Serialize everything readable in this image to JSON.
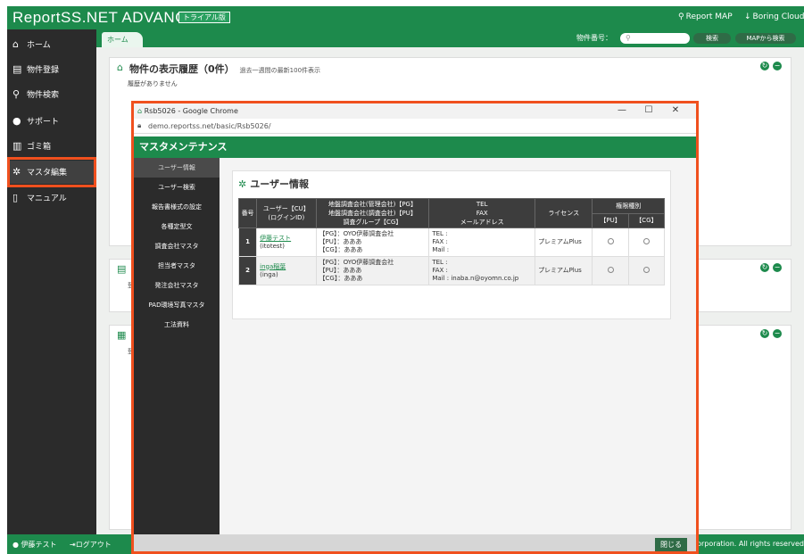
{
  "header": {
    "brand": "ReportSS.NET ADVANCE",
    "trial_badge": "トライアル版",
    "report_map": "Report MAP",
    "boring_cloud": "Boring Cloud"
  },
  "sidebar": {
    "items": [
      {
        "label": "ホーム",
        "icon": "home-icon"
      },
      {
        "label": "物件登録",
        "icon": "register-icon"
      },
      {
        "label": "物件検索",
        "icon": "search-icon"
      },
      {
        "label": "サポート",
        "icon": "user-icon"
      },
      {
        "label": "ゴミ箱",
        "icon": "trash-icon"
      },
      {
        "label": "マスタ編集",
        "icon": "gear-icon"
      },
      {
        "label": "マニュアル",
        "icon": "book-icon"
      }
    ]
  },
  "tabs": {
    "home": "ホーム",
    "search_label": "物件番号：",
    "search_button": "検索",
    "map_button": "MAPから検索"
  },
  "panel1": {
    "title": "物件の表示履歴（0件）",
    "subtitle": "過去一週間の最新100件表示",
    "note": "履歴がありません"
  },
  "panel2": {
    "note": "登録"
  },
  "panel3": {
    "note": "登録"
  },
  "footer": {
    "user": "伊藤テスト",
    "logout": "ログアウト",
    "copyright": "Corporation. All rights reserved"
  },
  "popup": {
    "window_title": "Rsb5026 - Google Chrome",
    "url": "demo.reportss.net/basic/Rsb5026/",
    "minimize": "—",
    "maximize": "☐",
    "close": "✕",
    "header": "マスタメンテナンス",
    "menu": [
      "ユーザー情報",
      "ユーザー検索",
      "報告書様式の設定",
      "各種定型文",
      "調査会社マスタ",
      "担当者マスタ",
      "発注会社マスタ",
      "PAD環境写真マスタ",
      "工法資料"
    ],
    "section_title": "ユーザー情報",
    "close_button": "閉じる"
  },
  "user_table": {
    "headers": {
      "no": "番号",
      "user": "ユーザー【CU】\n(ログインID)",
      "company": "地盤調査会社(管理会社)【PG】\n地盤調査会社(調査会社)【PU】\n調査グループ【CG】",
      "contact": "TEL\nFAX\nメールアドレス",
      "license": "ライセンス",
      "perm": "権限種別",
      "pu": "【PU】",
      "cg": "【CG】"
    },
    "rows": [
      {
        "no": "1",
        "name": "伊藤テスト",
        "login": "(itotest)",
        "company": "【PG】：OYO伊藤調査会社\n【PU】：あああ\n【CG】：あああ",
        "contact": "TEL :\nFAX :\nMail :",
        "license": "プレミアムPlus"
      },
      {
        "no": "2",
        "name": "inga稲葉",
        "login": "(inga)",
        "company": "【PG】：OYO伊藤調査会社\n【PU】：あああ\n【CG】：あああ",
        "contact": "TEL :\nFAX :\nMail : inaba.n@oyomn.co.jp",
        "license": "プレミアムPlus"
      }
    ]
  },
  "colors": {
    "brand_green": "#1d8a4c",
    "highlight": "#f0501e",
    "sidebar_dark": "#2b2b2b"
  }
}
